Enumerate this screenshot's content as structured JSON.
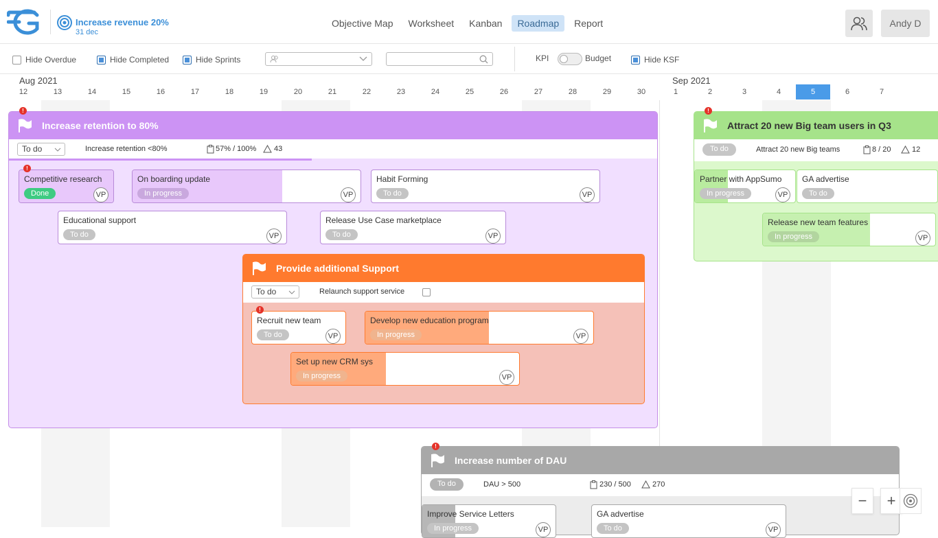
{
  "header": {
    "goal_title": "Increase revenue 20%",
    "goal_date": "31 dec",
    "nav": [
      "Objective Map",
      "Worksheet",
      "Kanban",
      "Roadmap",
      "Report"
    ],
    "active_tab": "Roadmap",
    "user_name": "Andy D",
    "accent": "#3b8fd8"
  },
  "filters": {
    "hide_overdue": "Hide Overdue",
    "hide_completed": "Hide Completed",
    "hide_sprints": "Hide Sprints",
    "kpi": "KPI",
    "budget": "Budget",
    "hide_ksf": "Hide KSF",
    "hide_overdue_checked": false,
    "hide_completed_checked": true,
    "hide_sprints_checked": true,
    "hide_ksf_checked": true
  },
  "timeline": {
    "month1": "Aug 2021",
    "month2": "Sep 2021",
    "days_aug": [
      "12",
      "13",
      "14",
      "15",
      "16",
      "17",
      "18",
      "19",
      "20",
      "21",
      "22",
      "23",
      "24",
      "25",
      "26",
      "27",
      "28",
      "29",
      "30"
    ],
    "days_sep": [
      "1",
      "2",
      "3",
      "4",
      "5",
      "6",
      "7"
    ],
    "today": "5"
  },
  "objectives": {
    "retention": {
      "title": "Increase retention to 80%",
      "status": "To do",
      "kpi": "Increase retention <80%",
      "progress": "57% / 100%",
      "delta": "43",
      "color": "#cc93f4"
    },
    "support": {
      "title": "Provide additional Support",
      "status": "To do",
      "kpi": "Relaunch support service",
      "color": "#ff7a2e"
    },
    "bigteam": {
      "title": "Attract 20 new Big team users in Q3",
      "status": "To do",
      "kpi": "Attract 20 new Big teams",
      "progress": "8 / 20",
      "delta": "12",
      "color": "#a6e38a"
    },
    "dau": {
      "title": "Increase number of DAU",
      "status": "To do",
      "kpi": "DAU > 500",
      "progress": "230 / 500",
      "delta": "270",
      "color": "#a8a8a8"
    }
  },
  "cards": {
    "competitive": {
      "title": "Competitive research",
      "status": "Done",
      "owner": "VP"
    },
    "onboarding": {
      "title": "On boarding update",
      "status": "In progress",
      "owner": "VP"
    },
    "habit": {
      "title": "Habit Forming",
      "status": "To do",
      "owner": "VP"
    },
    "educational": {
      "title": "Educational support",
      "status": "To do",
      "owner": "VP"
    },
    "usecase": {
      "title": "Release Use Case marketplace",
      "status": "To do",
      "owner": "VP"
    },
    "recruit": {
      "title": "Recruit new team",
      "status": "To do",
      "owner": "VP"
    },
    "education_prog": {
      "title": "Develop new education program",
      "status": "In progress",
      "owner": "VP"
    },
    "crm": {
      "title": "Set up new CRM sys",
      "status": "In progress",
      "owner": "VP"
    },
    "appsumo": {
      "title": "Partner with AppSumo",
      "status": "In progress",
      "owner": "VP"
    },
    "ga1": {
      "title": "GA advertise",
      "status": "To do",
      "owner": ""
    },
    "teamfeatures": {
      "title": "Release new team features",
      "status": "In progress",
      "owner": "VP"
    },
    "letters": {
      "title": "Improve Service Letters",
      "status": "In progress",
      "owner": "VP"
    },
    "ga2": {
      "title": "GA advertise",
      "status": "To do",
      "owner": "VP"
    }
  },
  "zoom": {
    "minus": "−",
    "plus": "+"
  }
}
